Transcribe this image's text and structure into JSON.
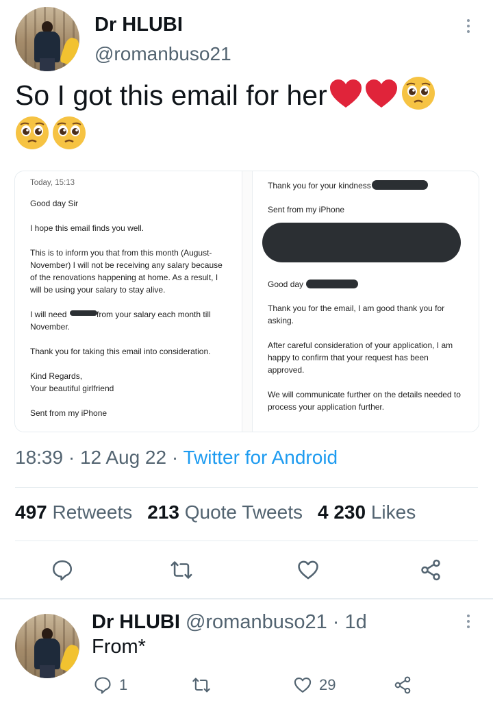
{
  "tweet": {
    "author_name": "Dr HLUBI",
    "author_handle": "@romanbuso21",
    "text": "So I got this email for her",
    "timestamp": "18:39 · 12 Aug 22 · ",
    "source": "Twitter for Android",
    "stats": {
      "retweets_count": "497",
      "retweets_label": "Retweets",
      "quotes_count": "213",
      "quotes_label": "Quote Tweets",
      "likes_count": "4 230",
      "likes_label": "Likes"
    }
  },
  "email_left": {
    "date": "Today, 15:13",
    "greeting": "Good day Sir",
    "line1": "I hope this email finds you well.",
    "para1": "This is to inform you that from this month (August-\nNovember) I will not be receiving any salary because\nof the renovations happening at home. As a result, I\nwill be using your salary to stay alive.",
    "need_a": "I will need",
    "need_b": "from your salary each month till",
    "need_c": "November.",
    "thanks": "Thank you for taking this email into consideration.",
    "signoff": "Kind Regards,\nYour beautiful girlfriend",
    "sent": "Sent from my iPhone"
  },
  "email_right": {
    "thanks_kindness": "Thank you for your kindness",
    "sent": "Sent from my iPhone",
    "good_day": "Good day",
    "reply1": "Thank you for the email, I am good thank you for\nasking.",
    "reply2": "After careful consideration of your application, I am\nhappy to confirm that your request has been\napproved.",
    "reply3": "We will communicate further on the details needed to\nprocess your application further."
  },
  "reply": {
    "author_name": "Dr HLUBI",
    "author_handle": "@romanbuso21",
    "age": "· 1d",
    "text": "From*",
    "reply_count": "1",
    "like_count": "29"
  },
  "icons": {
    "reply": "reply-icon",
    "retweet": "retweet-icon",
    "like": "heart-icon",
    "share": "share-icon",
    "more": "more-icon"
  },
  "colors": {
    "link": "#1d9bf0",
    "secondary_text": "#536471",
    "heart_emoji": "#e0243a",
    "redaction": "#2b2f33"
  }
}
